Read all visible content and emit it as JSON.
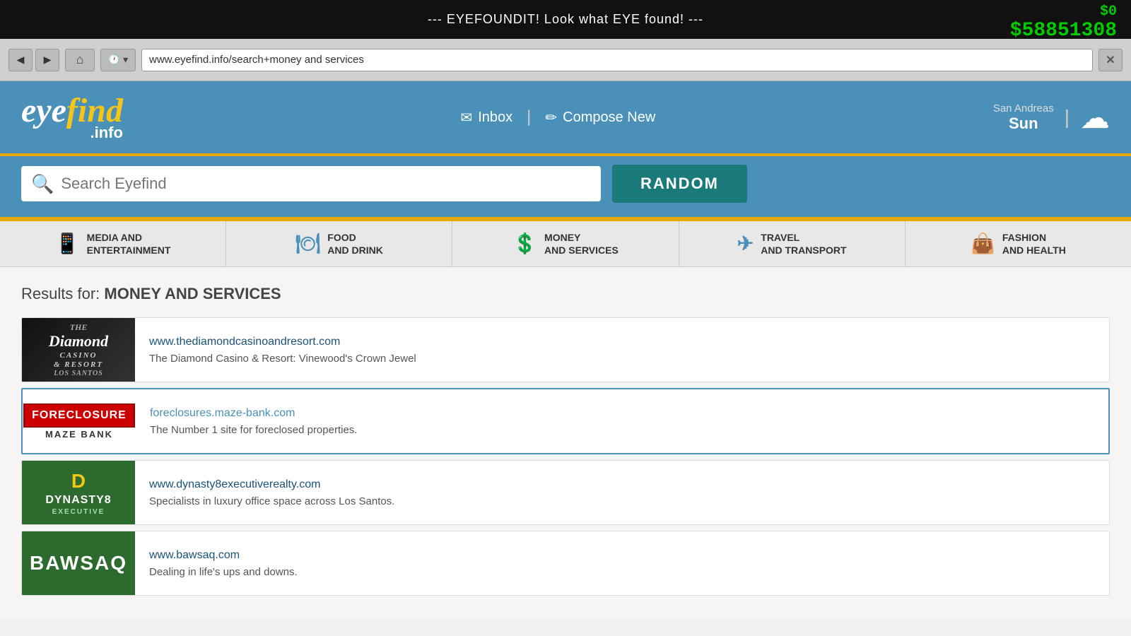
{
  "topBar": {
    "title": "--- EYEFOUNDIT! Look what EYE found! ---",
    "moneyCurrentLabel": "$0",
    "moneyTotalLabel": "$58851308"
  },
  "browserChrome": {
    "addressBarValue": "www.eyefind.info/search+money and services",
    "backBtn": "◀",
    "forwardBtn": "▶",
    "homeBtn": "⌂",
    "historyBtn": "🕐",
    "closeBtn": "✕"
  },
  "header": {
    "logoEye": "eye",
    "logoFind": "find",
    "logoDotInfo": ".info",
    "inboxLabel": "Inbox",
    "composeLabel": "Compose New",
    "locationLabel": "San Andreas",
    "dayLabel": "Sun"
  },
  "search": {
    "placeholder": "Search Eyefind",
    "randomLabel": "RANDOM"
  },
  "categories": [
    {
      "id": "media",
      "icon": "📱",
      "line1": "MEDIA AND",
      "line2": "ENTERTAINMENT"
    },
    {
      "id": "food",
      "icon": "🍽",
      "line1": "FOOD",
      "line2": "AND DRINK"
    },
    {
      "id": "money",
      "icon": "💲",
      "line1": "MONEY",
      "line2": "AND SERVICES"
    },
    {
      "id": "travel",
      "icon": "✈",
      "line1": "TRAVEL",
      "line2": "AND TRANSPORT"
    },
    {
      "id": "fashion",
      "icon": "👜",
      "line1": "FASHION",
      "line2": "AND HEALTH"
    }
  ],
  "results": {
    "heading": "Results for:",
    "query": "MONEY AND SERVICES",
    "items": [
      {
        "id": "diamond",
        "thumbType": "diamond",
        "url": "www.thediamondcasinoandresort.com",
        "description": "The Diamond Casino & Resort: Vinewood's Crown Jewel",
        "highlighted": false
      },
      {
        "id": "foreclosure",
        "thumbType": "foreclosure",
        "url": "foreclosures.maze-bank.com",
        "description": "The Number 1 site for foreclosed properties.",
        "highlighted": true
      },
      {
        "id": "dynasty",
        "thumbType": "dynasty",
        "url": "www.dynasty8executiverealty.com",
        "description": "Specialists in luxury office space across Los Santos.",
        "highlighted": false
      },
      {
        "id": "bawsaq",
        "thumbType": "bawsaq",
        "url": "www.bawsaq.com",
        "description": "Dealing in life's ups and downs.",
        "highlighted": false
      }
    ]
  }
}
